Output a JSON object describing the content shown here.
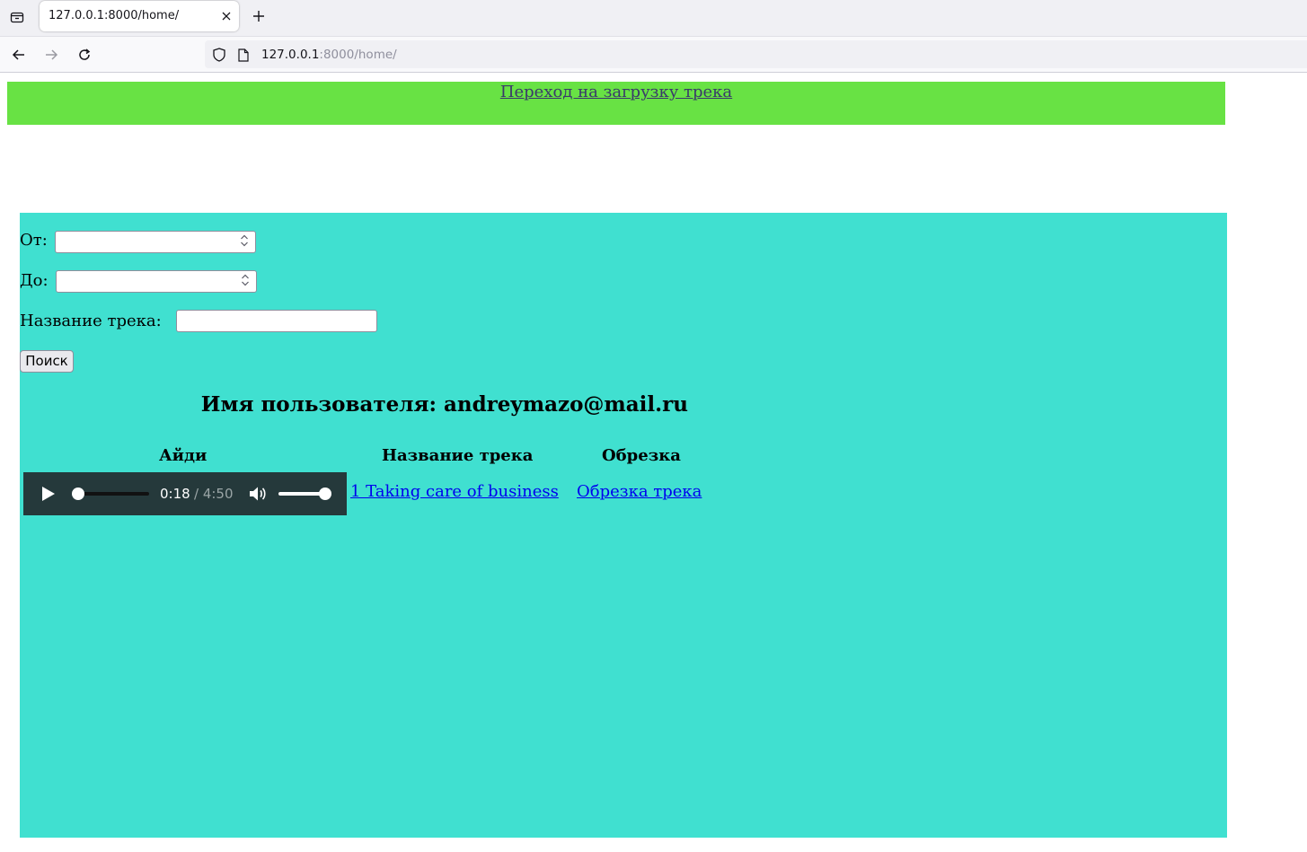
{
  "browser": {
    "tab": {
      "title": "127.0.0.1:8000/home/"
    },
    "url": {
      "host": "127.0.0.1",
      "rest": ":8000/home/"
    }
  },
  "banner": {
    "link_text": "Переход на загрузку трека"
  },
  "filters": {
    "from_label": "От:",
    "from_value": "",
    "to_label": "До:",
    "to_value": "",
    "title_label": "Название трека:",
    "title_value": "",
    "search_button": "Поиск"
  },
  "user_heading": "Имя пользователя: andreymazo@mail.ru",
  "table": {
    "headers": [
      "Айди",
      "Название трека",
      "Обрезка"
    ],
    "rows": [
      {
        "player": {
          "current_time": "0:18",
          "duration": "/ 4:50",
          "progress": 0.062,
          "volume": 1.0
        },
        "track_link": "1 Taking care of business",
        "trim_link": "Обрезка трека"
      }
    ]
  },
  "colors": {
    "banner_bg": "#68e244",
    "panel_bg": "#40e0d0",
    "player_bg": "#25393b",
    "link": "#0000ee"
  }
}
